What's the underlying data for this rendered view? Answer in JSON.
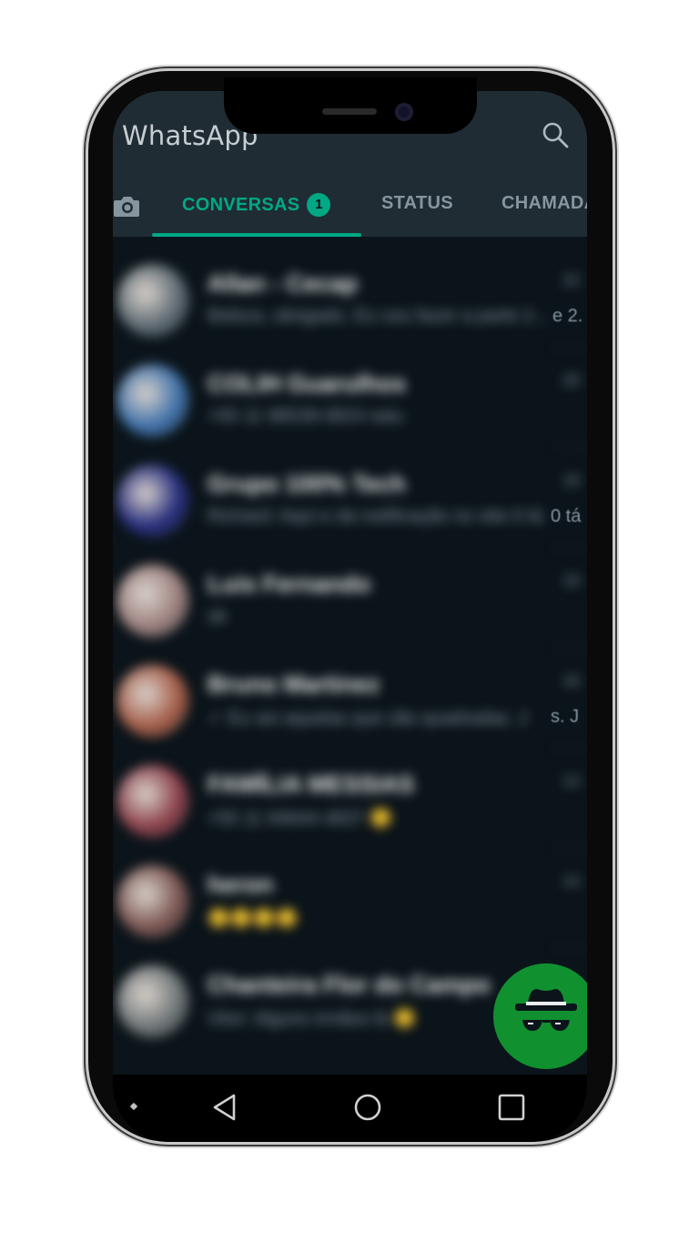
{
  "app": {
    "title": "WhatsApp"
  },
  "tabs": {
    "conversas": {
      "label": "CONVERSAS",
      "badge": "1"
    },
    "status": {
      "label": "STATUS"
    },
    "chamadas": {
      "label": "CHAMADA"
    }
  },
  "chats": [
    {
      "name": "Allan - Cecap",
      "message": "Beleza, obrigado. Eu vou fazer a parte 2...",
      "time": "22",
      "avatar_color": "#5d6a72"
    },
    {
      "name": "COLIH Guarulhos",
      "message": "+55 11 98539-0824 saiu",
      "time": "20",
      "avatar_color": "#3d6fa8"
    },
    {
      "name": "Grupo 100% Tech",
      "message": "Richard: Aqui e da notificação no site 0 tá",
      "time": "19",
      "avatar_color": "#232a7a"
    },
    {
      "name": "Luis Fernando",
      "message": "ok",
      "time": "19",
      "avatar_color": "#9a7e7c"
    },
    {
      "name": "Bruno Martinez",
      "message": "✓ Eu sei aquelas que são quadradas. J",
      "time": "16",
      "avatar_color": "#a35a45"
    },
    {
      "name": "FAMÍLIA MESSIAS",
      "message": "+55 11 94644-4837 😊",
      "time": "14",
      "avatar_color": "#8a3e48"
    },
    {
      "name": "heron",
      "message": "😊😊😊😊",
      "time": "14",
      "avatar_color": "#7a5450"
    },
    {
      "name": "Chanteira Flor do Campo",
      "message": "Vitor: Alguns irmãos lá 😊",
      "time": "",
      "avatar_color": "#6d7476"
    }
  ],
  "peek_text": {
    "row1": "e 2.",
    "row3": "0 tá",
    "row5": "s. J"
  },
  "colors": {
    "accent": "#00a884",
    "appbar": "#1f2c34",
    "background": "#0b141a",
    "fab": "#10902f"
  },
  "icons": {
    "search": "search-icon",
    "camera": "camera-icon",
    "fab": "incognito-hat-glasses-icon",
    "nav_back": "triangle-back-icon",
    "nav_home": "circle-home-icon",
    "nav_recents": "square-recents-icon"
  }
}
